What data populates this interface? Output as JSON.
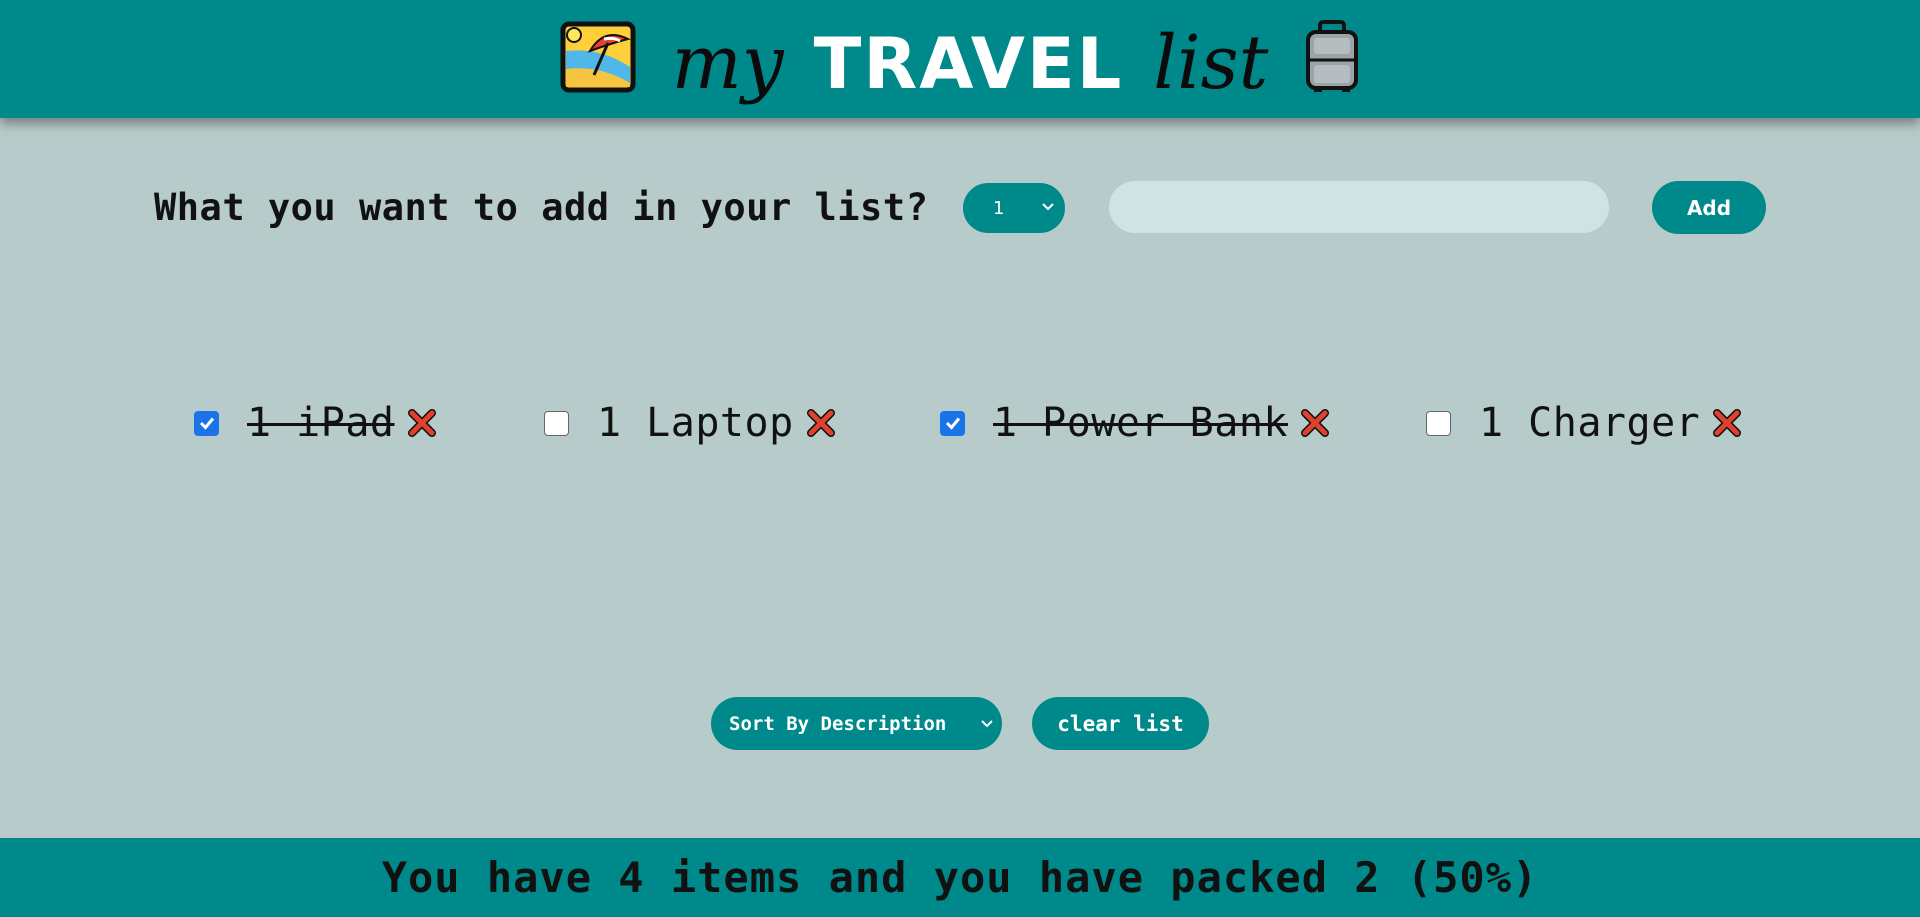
{
  "header": {
    "title_word1": "my",
    "title_word2": "TRAVEL",
    "title_word3": "list",
    "left_icon": "beach-umbrella-icon",
    "right_icon": "luggage-icon"
  },
  "form": {
    "question": "What you want to add in your list?",
    "quantity_value": "1",
    "item_value": "",
    "add_label": "Add"
  },
  "items": [
    {
      "text": "1 iPad",
      "packed": true
    },
    {
      "text": "1 Laptop",
      "packed": false
    },
    {
      "text": "1 Power Bank",
      "packed": true
    },
    {
      "text": "1 Charger",
      "packed": false
    }
  ],
  "controls": {
    "sort_value": "Sort By Description",
    "clear_label": "clear list"
  },
  "footer": {
    "stats": "You have 4 items and you have packed 2 (50%)"
  },
  "colors": {
    "teal": "#00898a",
    "background": "#b7cbca",
    "checkbox_checked": "#1a73e8",
    "delete_red": "#e0402c"
  }
}
